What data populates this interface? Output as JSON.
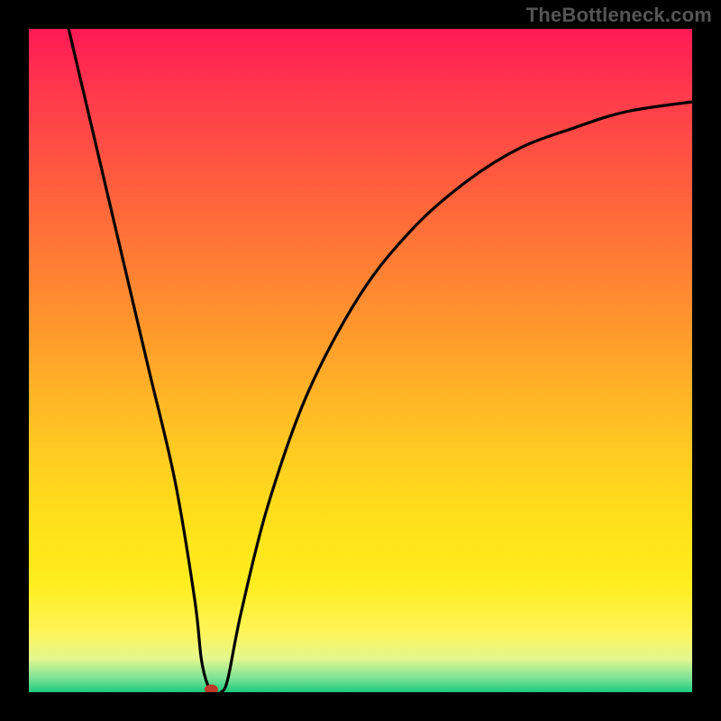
{
  "watermark": "TheBottleneck.com",
  "chart_data": {
    "type": "line",
    "title": "",
    "xlabel": "",
    "ylabel": "",
    "xlim": [
      0,
      100
    ],
    "ylim": [
      0,
      100
    ],
    "grid": false,
    "legend": false,
    "curve": {
      "x": [
        6,
        10,
        14,
        18,
        22,
        25,
        26,
        27,
        28,
        29,
        30,
        32,
        36,
        42,
        50,
        58,
        66,
        74,
        82,
        90,
        100
      ],
      "y": [
        100,
        83,
        66,
        49,
        32,
        14,
        5,
        1,
        0,
        0,
        2,
        12,
        28,
        45,
        60,
        70,
        77,
        82,
        85,
        87.5,
        89
      ]
    },
    "optimal_point": {
      "x": 27.5,
      "y": 0
    },
    "gradient": {
      "top": "#ff1a55",
      "bottom": "#1acb7d"
    }
  }
}
